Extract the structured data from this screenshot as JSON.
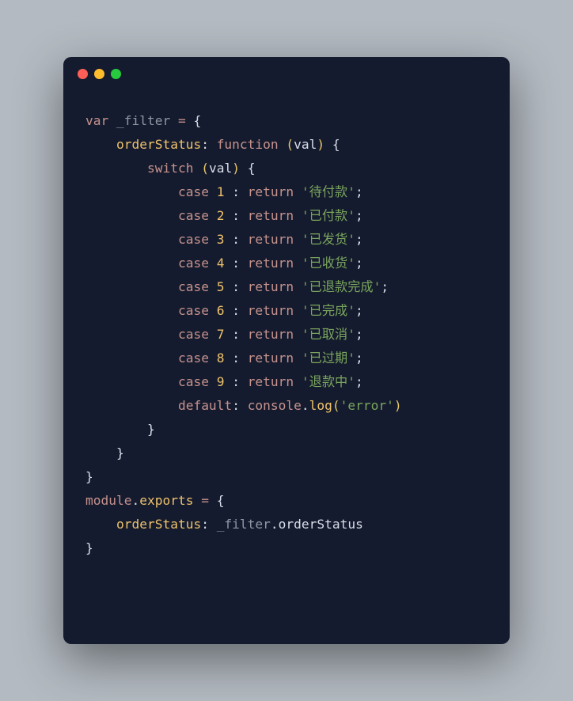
{
  "code": {
    "l01": {
      "kw_var": "var",
      "sp1": " ",
      "id": "_filter",
      "sp2": " ",
      "eq": "=",
      "sp3": " ",
      "brace": "{"
    },
    "l02": {
      "indent": "    ",
      "prop": "orderStatus",
      "colon": ":",
      "sp1": " ",
      "kw_fn": "function",
      "sp2": " ",
      "lp": "(",
      "arg": "val",
      "rp": ")",
      "sp3": " ",
      "brace": "{"
    },
    "l03": {
      "indent": "        ",
      "kw": "switch",
      "sp1": " ",
      "lp": "(",
      "arg": "val",
      "rp": ")",
      "sp2": " ",
      "brace": "{"
    },
    "l04": {
      "indent": "            ",
      "case": "case",
      "sp1": " ",
      "num": "1",
      "sp2": " ",
      "colon": ":",
      "sp3": " ",
      "ret": "return",
      "sp4": " ",
      "q1": "'",
      "str": "待付款",
      "q2": "'",
      "semi": ";"
    },
    "l05": {
      "indent": "            ",
      "case": "case",
      "sp1": " ",
      "num": "2",
      "sp2": " ",
      "colon": ":",
      "sp3": " ",
      "ret": "return",
      "sp4": " ",
      "q1": "'",
      "str": "已付款",
      "q2": "'",
      "semi": ";"
    },
    "l06": {
      "indent": "            ",
      "case": "case",
      "sp1": " ",
      "num": "3",
      "sp2": " ",
      "colon": ":",
      "sp3": " ",
      "ret": "return",
      "sp4": " ",
      "q1": "'",
      "str": "已发货",
      "q2": "'",
      "semi": ";"
    },
    "l07": {
      "indent": "            ",
      "case": "case",
      "sp1": " ",
      "num": "4",
      "sp2": " ",
      "colon": ":",
      "sp3": " ",
      "ret": "return",
      "sp4": " ",
      "q1": "'",
      "str": "已收货",
      "q2": "'",
      "semi": ";"
    },
    "l08": {
      "indent": "            ",
      "case": "case",
      "sp1": " ",
      "num": "5",
      "sp2": " ",
      "colon": ":",
      "sp3": " ",
      "ret": "return",
      "sp4": " ",
      "q1": "'",
      "str": "已退款完成",
      "q2": "'",
      "semi": ";"
    },
    "l09": {
      "indent": "            ",
      "case": "case",
      "sp1": " ",
      "num": "6",
      "sp2": " ",
      "colon": ":",
      "sp3": " ",
      "ret": "return",
      "sp4": " ",
      "q1": "'",
      "str": "已完成",
      "q2": "'",
      "semi": ";"
    },
    "l10": {
      "indent": "            ",
      "case": "case",
      "sp1": " ",
      "num": "7",
      "sp2": " ",
      "colon": ":",
      "sp3": " ",
      "ret": "return",
      "sp4": " ",
      "q1": "'",
      "str": "已取消",
      "q2": "'",
      "semi": ";"
    },
    "l11": {
      "indent": "            ",
      "case": "case",
      "sp1": " ",
      "num": "8",
      "sp2": " ",
      "colon": ":",
      "sp3": " ",
      "ret": "return",
      "sp4": " ",
      "q1": "'",
      "str": "已过期",
      "q2": "'",
      "semi": ";"
    },
    "l12": {
      "indent": "            ",
      "case": "case",
      "sp1": " ",
      "num": "9",
      "sp2": " ",
      "colon": ":",
      "sp3": " ",
      "ret": "return",
      "sp4": " ",
      "q1": "'",
      "str": "退款中",
      "q2": "'",
      "semi": ";"
    },
    "l13": {
      "indent": "            ",
      "default": "default",
      "colon": ":",
      "sp1": " ",
      "obj": "console",
      "dot": ".",
      "method": "log",
      "lp": "(",
      "q1": "'",
      "str": "error",
      "q2": "'",
      "rp": ")"
    },
    "l14": {
      "indent": "        ",
      "brace": "}"
    },
    "l15": {
      "indent": "    ",
      "brace": "}"
    },
    "l16": {
      "brace": "}"
    },
    "l17": {
      "obj": "module",
      "dot": ".",
      "prop": "exports",
      "sp1": " ",
      "eq": "=",
      "sp2": " ",
      "brace": "{"
    },
    "l18": {
      "indent": "    ",
      "prop": "orderStatus",
      "colon": ":",
      "sp1": " ",
      "id": "_filter",
      "dot": ".",
      "prop2": "orderStatus"
    },
    "l19": {
      "brace": "}"
    }
  }
}
